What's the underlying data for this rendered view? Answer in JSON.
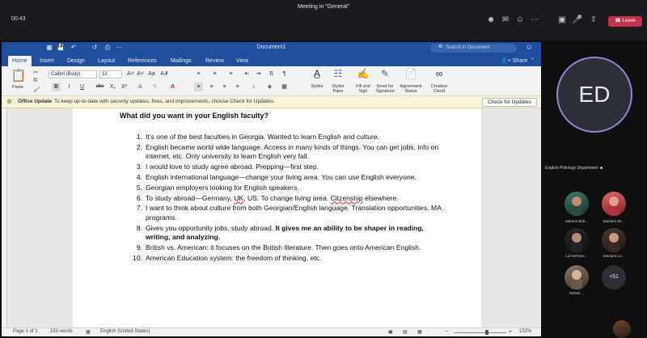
{
  "teams": {
    "meeting_title": "Meeting in \"General\"",
    "timer": "00:43",
    "leave_label": "Leave",
    "icons": [
      "people-icon",
      "chat-icon",
      "reactions-icon",
      "more-icon",
      "camera-icon",
      "mic-icon",
      "share-icon"
    ]
  },
  "word": {
    "doc_title": "Document1",
    "search_placeholder": "Search in Document",
    "share_label": "Share",
    "tabs": [
      "Home",
      "Insert",
      "Design",
      "Layout",
      "References",
      "Mailings",
      "Review",
      "View"
    ],
    "font_name": "Calibri (Body)",
    "font_size": "12",
    "paste_label": "Paste",
    "big_buttons": [
      {
        "label": "Styles",
        "icon": "styles-icon"
      },
      {
        "label": "Styles\nPane",
        "icon": "styles-pane-icon"
      },
      {
        "label": "Fill and\nSign",
        "icon": "fill-sign-icon"
      },
      {
        "label": "Send for\nSignature",
        "icon": "send-signature-icon"
      },
      {
        "label": "Agreement\nStatus",
        "icon": "agreement-status-icon"
      },
      {
        "label": "Creative\nCloud",
        "icon": "creative-cloud-icon"
      }
    ],
    "update_title": "Office Update",
    "update_text": "To keep up-to-date with security updates, fixes, and improvements, choose Check for Updates.",
    "update_button": "Check for Updates",
    "heading": "What did you want in your English faculty?",
    "list": [
      {
        "n": "1.",
        "text": "It’s one of the best faculties in Georgia. Wanted to learn English and culture."
      },
      {
        "n": "2.",
        "text": "English became world wide language. Access in many kinds of things. You can get jobs, info on internet, etc. Only university to learn English very fall."
      },
      {
        "n": "3.",
        "text": "I would love to study agree abroad. Prepping—first step."
      },
      {
        "n": "4.",
        "text": "English international language—change your living area. You can use English everyone."
      },
      {
        "n": "5.",
        "text": "Georgian employers looking for English speakers."
      },
      {
        "n": "6.",
        "text_a": "To study abroad—Germany, ",
        "text_b": "UK",
        "text_c": ", US. To change living area. ",
        "text_d": "Citzenship",
        "text_e": " elsewhere."
      },
      {
        "n": "7.",
        "text": "I want to think about culture from both Georgian/English language. Translation opportunities. MA programs."
      },
      {
        "n": "8.",
        "text_plain": "Gives you opportunity jobs, study abroad. ",
        "text_bold": "It gives me an ability to be shaper in reading, writing, and analyzing."
      },
      {
        "n": "9.",
        "text": "British vs. American: it focuses on the British literature. Then goes onto American English."
      },
      {
        "n": "10.",
        "text": "American Education system: the freedom of thinking, etc."
      }
    ],
    "status": {
      "page": "Page 1 of 1",
      "words": "153 words",
      "language": "English (United States)",
      "zoom": "152%"
    }
  },
  "gallery": {
    "self_initials": "ED",
    "group_label": "English Philology Department",
    "participants": [
      {
        "name": "Salome Bob..."
      },
      {
        "name": "Mariami Zh..."
      },
      {
        "name": "Lizi Mchvee..."
      },
      {
        "name": "Mariami Lo..."
      },
      {
        "name": "Mzbeli ..."
      }
    ],
    "more_count": "+51"
  }
}
